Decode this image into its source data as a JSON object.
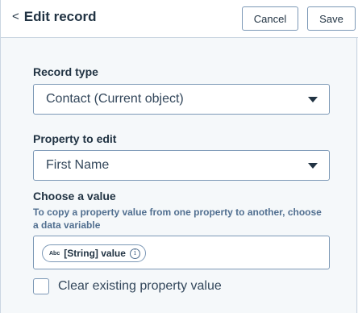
{
  "header": {
    "back_chevron": "<",
    "title": "Edit record",
    "cancel_label": "Cancel",
    "save_label": "Save"
  },
  "form": {
    "record_type": {
      "label": "Record type",
      "selected": "Contact (Current object)"
    },
    "property": {
      "label": "Property to edit",
      "selected": "First Name"
    },
    "value": {
      "label": "Choose a value",
      "help": "To copy a property value from one property to another, choose a data variable",
      "token_type": "Abc",
      "token_label": "[String] value",
      "info_glyph": "i"
    },
    "clear_checkbox": {
      "label": "Clear existing property value",
      "checked": false
    }
  },
  "colors": {
    "text": "#213343",
    "border": "#7c98b6",
    "background": "#f5f8fa",
    "help_text": "#516f90"
  }
}
